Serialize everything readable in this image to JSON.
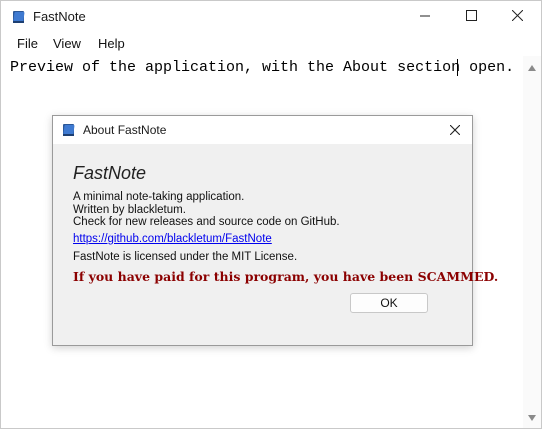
{
  "window": {
    "title": "FastNote",
    "icon": "notebook-icon",
    "controls": [
      "minimize-icon",
      "maximize-icon",
      "close-icon"
    ]
  },
  "menubar": {
    "items": [
      {
        "label": "File"
      },
      {
        "label": "View"
      },
      {
        "label": "Help"
      }
    ]
  },
  "editor": {
    "text": "Preview of the application, with the About section open."
  },
  "about_dialog": {
    "title": "About FastNote",
    "app_name": "FastNote",
    "description_lines": [
      "A minimal note-taking application.",
      "Written by blackletum.",
      "Check for new releases and source code on GitHub."
    ],
    "link": "https://github.com/blackletum/FastNote",
    "license": "FastNote is licensed under the MIT License.",
    "warning": "If you have paid for this program, you have been SCAMMED.",
    "ok_label": "OK"
  },
  "colors": {
    "warning": "#8b0000",
    "link": "#0000ee",
    "dialog_bg": "#f0f0f0"
  }
}
